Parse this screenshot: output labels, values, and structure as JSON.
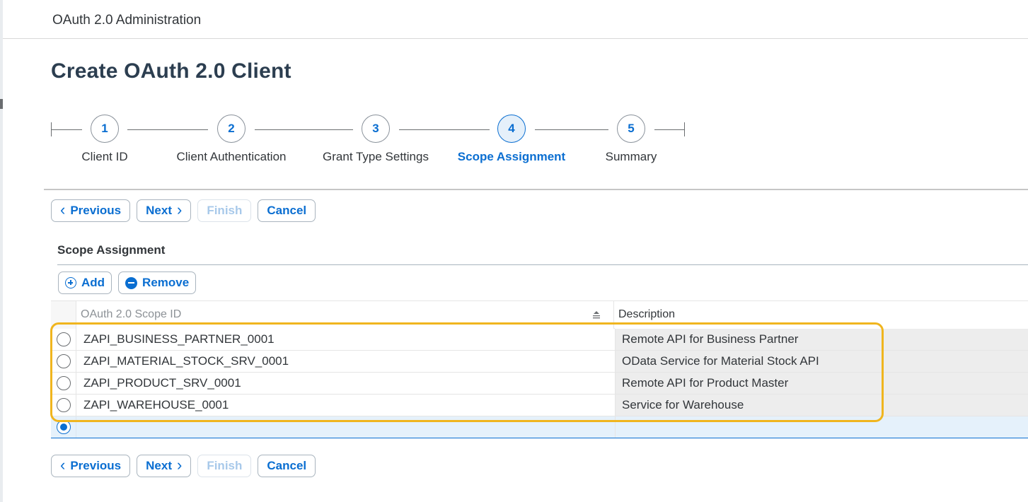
{
  "app": {
    "title": "OAuth 2.0 Administration"
  },
  "page": {
    "title": "Create OAuth 2.0 Client"
  },
  "wizard": {
    "steps": [
      {
        "number": "1",
        "label": "Client ID",
        "active": false
      },
      {
        "number": "2",
        "label": "Client Authentication",
        "active": false
      },
      {
        "number": "3",
        "label": "Grant Type Settings",
        "active": false
      },
      {
        "number": "4",
        "label": "Scope Assignment",
        "active": true
      },
      {
        "number": "5",
        "label": "Summary",
        "active": false
      }
    ]
  },
  "nav_buttons": {
    "previous": "Previous",
    "next": "Next",
    "finish": "Finish",
    "cancel": "Cancel"
  },
  "scope_section": {
    "title": "Scope Assignment",
    "add_label": "Add",
    "remove_label": "Remove"
  },
  "table": {
    "columns": {
      "scope_id": "OAuth 2.0 Scope ID",
      "description": "Description"
    },
    "rows": [
      {
        "scope_id": "ZAPI_BUSINESS_PARTNER_0001",
        "description": "Remote API for Business Partner",
        "selected": false
      },
      {
        "scope_id": "ZAPI_MATERIAL_STOCK_SRV_0001",
        "description": "OData Service for Material Stock API",
        "selected": false
      },
      {
        "scope_id": "ZAPI_PRODUCT_SRV_0001",
        "description": "Remote API for Product Master",
        "selected": false
      },
      {
        "scope_id": "ZAPI_WAREHOUSE_0001",
        "description": "Service for Warehouse",
        "selected": false
      },
      {
        "scope_id": "",
        "description": "",
        "selected": true
      }
    ]
  },
  "colors": {
    "accent": "#0a6ed1",
    "highlight": "#f0b51e",
    "title": "#2c3e50"
  }
}
